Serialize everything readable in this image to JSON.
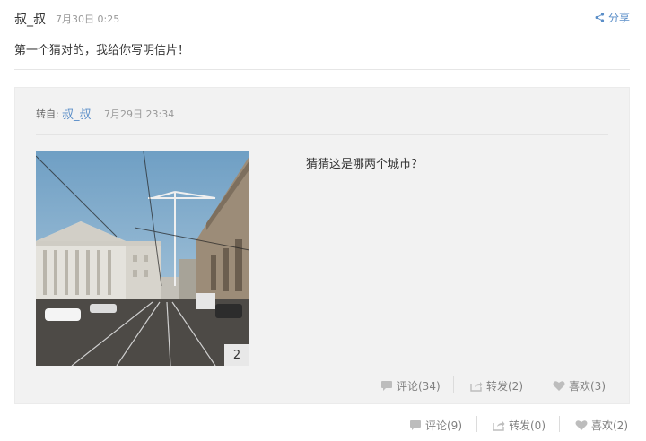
{
  "post": {
    "author": "叔_叔",
    "time": "7月30日 0:25",
    "share_label": "分享",
    "text": "第一个猜对的，我给你写明信片！"
  },
  "repost": {
    "from_label": "转自:",
    "author": "叔_叔",
    "time": "7月29日 23:34",
    "text": "猜猜这是哪两个城市？",
    "image_count": "2",
    "actions": {
      "comment": "评论(34)",
      "forward": "转发(2)",
      "like": "喜欢(3)"
    }
  },
  "actions": {
    "comment": "评论(9)",
    "forward": "转发(0)",
    "like": "喜欢(2)"
  },
  "colors": {
    "link": "#5a8ec8",
    "muted": "#999999",
    "panel": "#f2f2f2"
  },
  "icons": [
    "share-icon",
    "comment-icon",
    "forward-icon",
    "like-icon"
  ]
}
